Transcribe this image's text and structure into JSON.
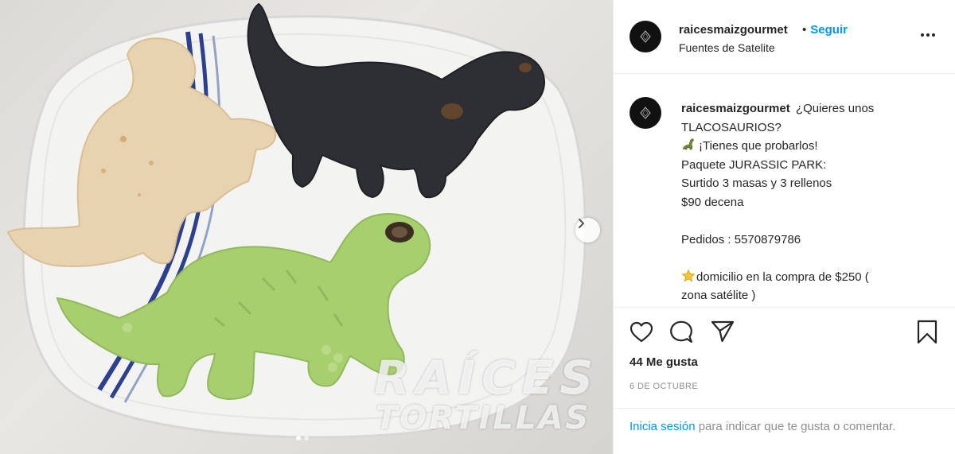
{
  "post": {
    "username": "raicesmaizgourmet",
    "follow_label": "Seguir",
    "follow_separator": "•",
    "location": "Fuentes de Satelite",
    "caption": {
      "username": "raicesmaizgourmet",
      "line1": "¿Quieres unos",
      "line2": "TLACOSAURIOS?",
      "line3": "¡Tienes que probarlos!",
      "line4": "Paquete JURASSIC PARK:",
      "line5": "Surtido 3 masas y 3 rellenos",
      "line6": "$90 decena",
      "line7": "",
      "line8": "Pedidos : 5570879786",
      "line9": "",
      "line10": "domicilio en la compra de $250 (",
      "line11": "zona satélite )"
    },
    "likes": "44 Me gusta",
    "date": "6 DE OCTUBRE",
    "login": {
      "link": "Inicia sesión",
      "rest": " para indicar que te gusta o comentar."
    },
    "watermark": {
      "line1": "RAÍCES",
      "line2": "TORTILLAS"
    }
  },
  "icons": {
    "more": "more-options-icon",
    "like": "heart-icon",
    "comment": "comment-icon",
    "share": "share-icon",
    "save": "bookmark-icon",
    "next": "chevron-right-icon",
    "dino_emoji": "sauropod-icon",
    "star_emoji": "star-icon"
  },
  "colors": {
    "link_blue": "#0095f6",
    "text": "#262626",
    "muted": "#8e8e8e",
    "border": "#efefef"
  },
  "carousel": {
    "slide_count": 2,
    "active_index": 0
  }
}
